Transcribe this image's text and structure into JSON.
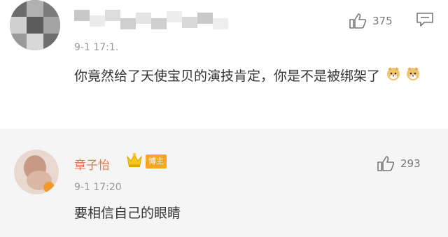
{
  "comments": [
    {
      "username": "",
      "time": "9-1 17:1.",
      "text": "你竟然给了天使宝贝的演技肯定，你是不是被绑架了",
      "likes": "375",
      "icons": [
        "thumb-up-icon",
        "message-icon",
        "doge-emoji",
        "doge-emoji"
      ]
    },
    {
      "username": "章子怡",
      "badge": "博主",
      "time": "9-1 17:20",
      "text": "要相信自己的眼睛",
      "likes": "293",
      "colors": {
        "username": "#eb7350",
        "badge": "#f5a623"
      }
    }
  ]
}
